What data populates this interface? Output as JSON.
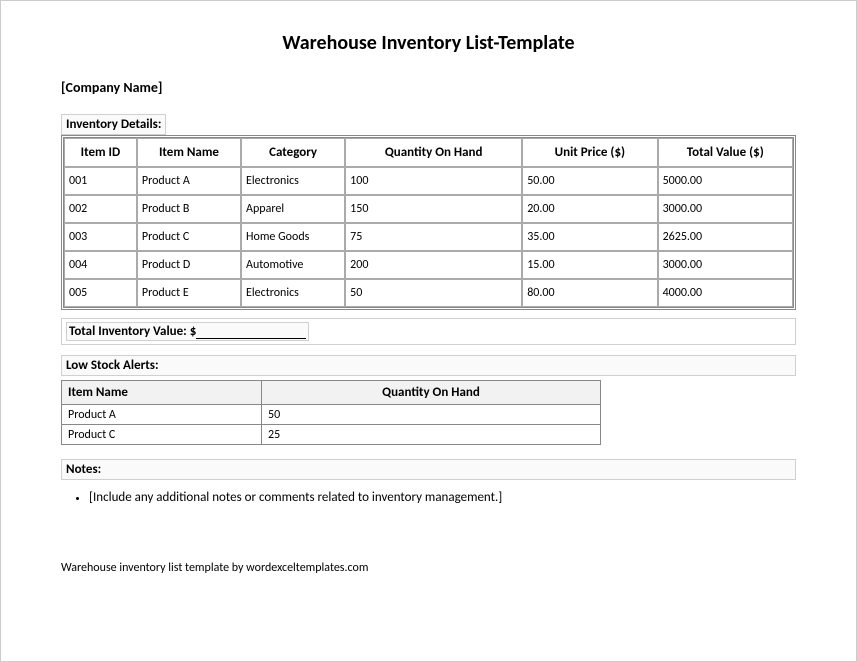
{
  "title": "Warehouse Inventory List-Template",
  "company_placeholder": "[Company Name]",
  "inventory_details_label": "Inventory Details:",
  "inventory_headers": {
    "item_id": "Item ID",
    "item_name": "Item Name",
    "category": "Category",
    "qoh": "Quantity On Hand",
    "unit_price": "Unit Price ($)",
    "total_value": "Total Value ($)"
  },
  "inventory_rows": [
    {
      "id": "001",
      "name": "Product A",
      "category": "Electronics",
      "qoh": "100",
      "unit": "50.00",
      "total": "5000.00"
    },
    {
      "id": "002",
      "name": "Product B",
      "category": "Apparel",
      "qoh": "150",
      "unit": "20.00",
      "total": "3000.00"
    },
    {
      "id": "003",
      "name": "Product C",
      "category": "Home Goods",
      "qoh": "75",
      "unit": "35.00",
      "total": "2625.00"
    },
    {
      "id": "004",
      "name": "Product D",
      "category": "Automotive",
      "qoh": "200",
      "unit": "15.00",
      "total": "3000.00"
    },
    {
      "id": "005",
      "name": "Product E",
      "category": "Electronics",
      "qoh": "50",
      "unit": "80.00",
      "total": "4000.00"
    }
  ],
  "total_inventory_label": "Total Inventory Value: $",
  "low_stock_label": "Low Stock Alerts:",
  "low_stock_headers": {
    "item_name": "Item Name",
    "qoh": "Quantity On Hand"
  },
  "low_stock_rows": [
    {
      "name": "Product A",
      "qoh": "50"
    },
    {
      "name": "Product C",
      "qoh": "25"
    }
  ],
  "notes_label": "Notes:",
  "notes_bullet": "[Include any additional notes or comments related to inventory management.]",
  "footer": "Warehouse inventory list template by wordexceltemplates.com"
}
